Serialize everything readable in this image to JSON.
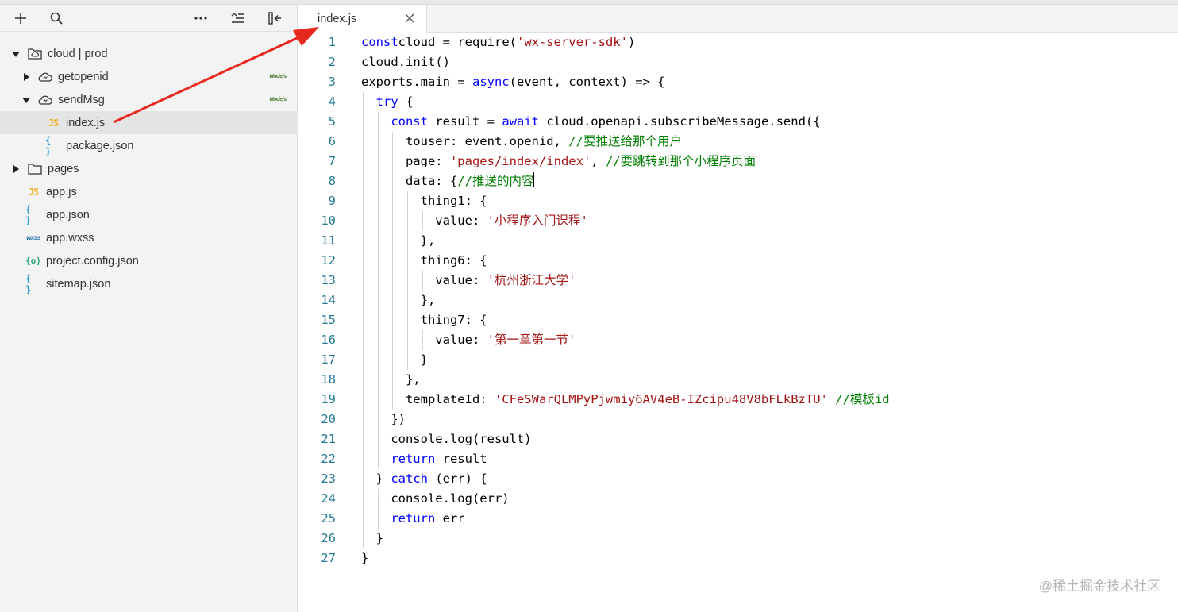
{
  "sidebar": {
    "tree": [
      {
        "label": "cloud | prod",
        "kind": "cloud-folder",
        "depth": 0,
        "caret": "open"
      },
      {
        "label": "getopenid",
        "kind": "cloud-fn",
        "depth": 1,
        "caret": "closed",
        "badge": "Nodejs"
      },
      {
        "label": "sendMsg",
        "kind": "cloud-fn",
        "depth": 1,
        "caret": "open",
        "badge": "Nodejs"
      },
      {
        "label": "index.js",
        "kind": "js",
        "depth": 2,
        "selected": true
      },
      {
        "label": "package.json",
        "kind": "json",
        "depth": 2
      },
      {
        "label": "pages",
        "kind": "folder",
        "depth": 0,
        "caret": "closed"
      },
      {
        "label": "app.js",
        "kind": "js",
        "depth": 0
      },
      {
        "label": "app.json",
        "kind": "json",
        "depth": 0
      },
      {
        "label": "app.wxss",
        "kind": "wxss",
        "depth": 0
      },
      {
        "label": "project.config.json",
        "kind": "config",
        "depth": 0
      },
      {
        "label": "sitemap.json",
        "kind": "json",
        "depth": 0
      }
    ],
    "icon_text": {
      "js": "JS",
      "json": "{ }",
      "wxss": "wxss",
      "config": "{o}"
    }
  },
  "editor": {
    "tab_label": "index.js",
    "cursor_line": 8,
    "lines": [
      {
        "n": "1",
        "indent": 0,
        "parts": [
          [
            "kw",
            "const"
          ],
          [
            "",
            "cloud = require("
          ],
          [
            "str",
            "'wx-server-sdk'"
          ],
          [
            "",
            ")"
          ]
        ]
      },
      {
        "n": "2",
        "indent": 0,
        "parts": [
          [
            "",
            "cloud.init()"
          ]
        ]
      },
      {
        "n": "3",
        "indent": 0,
        "parts": [
          [
            "",
            "exports.main = "
          ],
          [
            "kw",
            "async"
          ],
          [
            "",
            "(event, context) => {"
          ]
        ]
      },
      {
        "n": "4",
        "indent": 1,
        "parts": [
          [
            "kw",
            "try"
          ],
          [
            "",
            " {"
          ]
        ]
      },
      {
        "n": "5",
        "indent": 2,
        "parts": [
          [
            "kw",
            "const"
          ],
          [
            "",
            " result = "
          ],
          [
            "kw",
            "await"
          ],
          [
            "",
            " cloud.openapi.subscribeMessage.send({"
          ]
        ]
      },
      {
        "n": "6",
        "indent": 3,
        "parts": [
          [
            "",
            "touser: event.openid, "
          ],
          [
            "cm",
            "//要推送给那个用户"
          ]
        ]
      },
      {
        "n": "7",
        "indent": 3,
        "parts": [
          [
            "",
            "page: "
          ],
          [
            "str",
            "'pages/index/index'"
          ],
          [
            "",
            ", "
          ],
          [
            "cm",
            "//要跳转到那个小程序页面"
          ]
        ]
      },
      {
        "n": "8",
        "indent": 3,
        "parts": [
          [
            "",
            "data: {"
          ],
          [
            "cm",
            "//推送的内容"
          ]
        ]
      },
      {
        "n": "9",
        "indent": 4,
        "parts": [
          [
            "",
            "thing1: {"
          ]
        ]
      },
      {
        "n": "10",
        "indent": 5,
        "parts": [
          [
            "",
            "value: "
          ],
          [
            "str",
            "'小程序入门课程'"
          ]
        ]
      },
      {
        "n": "11",
        "indent": 4,
        "parts": [
          [
            "",
            "},"
          ]
        ]
      },
      {
        "n": "12",
        "indent": 4,
        "parts": [
          [
            "",
            "thing6: {"
          ]
        ]
      },
      {
        "n": "13",
        "indent": 5,
        "parts": [
          [
            "",
            "value: "
          ],
          [
            "str",
            "'杭州浙江大学'"
          ]
        ]
      },
      {
        "n": "14",
        "indent": 4,
        "parts": [
          [
            "",
            "},"
          ]
        ]
      },
      {
        "n": "15",
        "indent": 4,
        "parts": [
          [
            "",
            "thing7: {"
          ]
        ]
      },
      {
        "n": "16",
        "indent": 5,
        "parts": [
          [
            "",
            "value: "
          ],
          [
            "str",
            "'第一章第一节'"
          ]
        ]
      },
      {
        "n": "17",
        "indent": 4,
        "parts": [
          [
            "",
            "}"
          ]
        ]
      },
      {
        "n": "18",
        "indent": 3,
        "parts": [
          [
            "",
            "},"
          ]
        ]
      },
      {
        "n": "19",
        "indent": 3,
        "parts": [
          [
            "",
            "templateId: "
          ],
          [
            "str",
            "'CFeSWarQLMPyPjwmiy6AV4eB-IZcipu48V8bFLkBzTU'"
          ],
          [
            "",
            " "
          ],
          [
            "cm",
            "//模板id"
          ]
        ]
      },
      {
        "n": "20",
        "indent": 2,
        "parts": [
          [
            "",
            "})"
          ]
        ]
      },
      {
        "n": "21",
        "indent": 2,
        "parts": [
          [
            "",
            "console.log(result)"
          ]
        ]
      },
      {
        "n": "22",
        "indent": 2,
        "parts": [
          [
            "kw",
            "return"
          ],
          [
            "",
            " result"
          ]
        ]
      },
      {
        "n": "23",
        "indent": 1,
        "parts": [
          [
            "",
            "} "
          ],
          [
            "kw",
            "catch"
          ],
          [
            "",
            " (err) {"
          ]
        ]
      },
      {
        "n": "24",
        "indent": 2,
        "parts": [
          [
            "",
            "console.log(err)"
          ]
        ]
      },
      {
        "n": "25",
        "indent": 2,
        "parts": [
          [
            "kw",
            "return"
          ],
          [
            "",
            " err"
          ]
        ]
      },
      {
        "n": "26",
        "indent": 1,
        "parts": [
          [
            "",
            "}"
          ]
        ]
      },
      {
        "n": "27",
        "indent": 0,
        "parts": [
          [
            "",
            "}"
          ]
        ]
      }
    ]
  },
  "annotation": {
    "color": "#e8281e"
  },
  "watermark": "@稀土掘金技术社区",
  "colors": {
    "keyword": "#0000ff",
    "string": "#a31515",
    "comment": "#008000",
    "line_number": "#237893"
  }
}
